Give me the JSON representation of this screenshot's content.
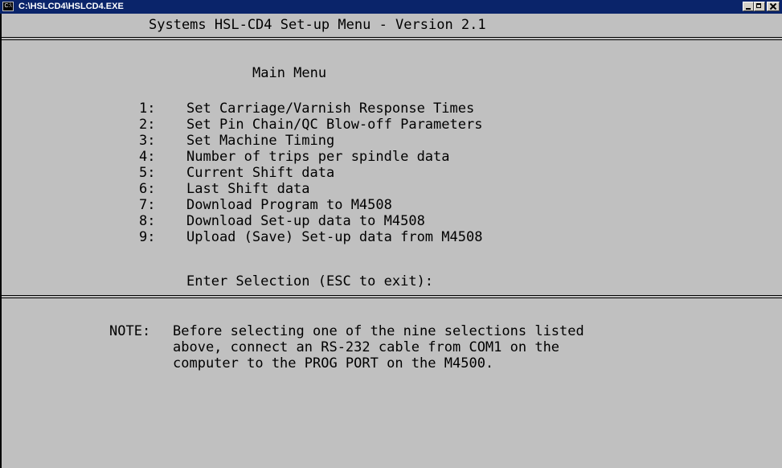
{
  "window": {
    "title": "C:\\HSLCD4\\HSLCD4.EXE",
    "icon": "console-icon",
    "icon_text": "C:\\"
  },
  "console": {
    "header": "Systems HSL-CD4 Set-up Menu - Version 2.1",
    "menu_title": "Main Menu",
    "menu_items": [
      {
        "num": "1:",
        "label": "Set Carriage/Varnish Response Times"
      },
      {
        "num": "2:",
        "label": "Set Pin Chain/QC Blow-off Parameters"
      },
      {
        "num": "3:",
        "label": "Set Machine Timing"
      },
      {
        "num": "4:",
        "label": "Number of trips per spindle data"
      },
      {
        "num": "5:",
        "label": "Current Shift data"
      },
      {
        "num": "6:",
        "label": "Last Shift data"
      },
      {
        "num": "7:",
        "label": "Download Program to M4508"
      },
      {
        "num": "8:",
        "label": "Download Set-up data to M4508"
      },
      {
        "num": "9:",
        "label": "Upload (Save) Set-up data from M4508"
      }
    ],
    "prompt": "Enter Selection (ESC to exit):",
    "note_label": "NOTE:",
    "note_lines": [
      "Before selecting one of the nine selections listed",
      "above, connect an RS-232 cable from COM1 on the",
      "computer to the PROG PORT on the M4500."
    ]
  },
  "colors": {
    "titlebar": "#0a246a",
    "console_background": "#c0c0c0",
    "console_text": "#000000"
  }
}
